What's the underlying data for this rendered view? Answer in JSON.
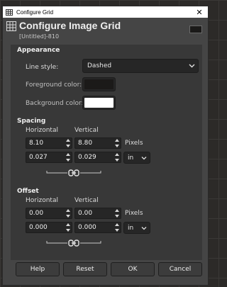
{
  "window": {
    "title": "Configure Grid",
    "close_glyph": "✕"
  },
  "header": {
    "title": "Configure Image Grid",
    "subtitle": "[Untitled]-810",
    "icon": "grid-icon"
  },
  "appearance": {
    "section_title": "Appearance",
    "line_style_label": "Line style:",
    "line_style_value": "Dashed",
    "foreground_label": "Foreground color:",
    "foreground_color": "#1b1a19",
    "background_label": "Background color:",
    "background_color": "#ffffff"
  },
  "spacing": {
    "section_title": "Spacing",
    "horizontal_header": "Horizontal",
    "vertical_header": "Vertical",
    "horizontal_px": "8.10",
    "vertical_px": "8.80",
    "px_unit": "Pixels",
    "horizontal_in": "0.027",
    "vertical_in": "0.029",
    "unit_value": "in",
    "chain": "chain-linked-icon"
  },
  "offset": {
    "section_title": "Offset",
    "horizontal_header": "Horizontal",
    "vertical_header": "Vertical",
    "horizontal_px": "0.00",
    "vertical_px": "0.00",
    "px_unit": "Pixels",
    "horizontal_in": "0.000",
    "vertical_in": "0.000",
    "unit_value": "in",
    "chain": "chain-linked-icon"
  },
  "buttons": {
    "help": "Help",
    "reset": "Reset",
    "ok": "OK",
    "cancel": "Cancel"
  }
}
